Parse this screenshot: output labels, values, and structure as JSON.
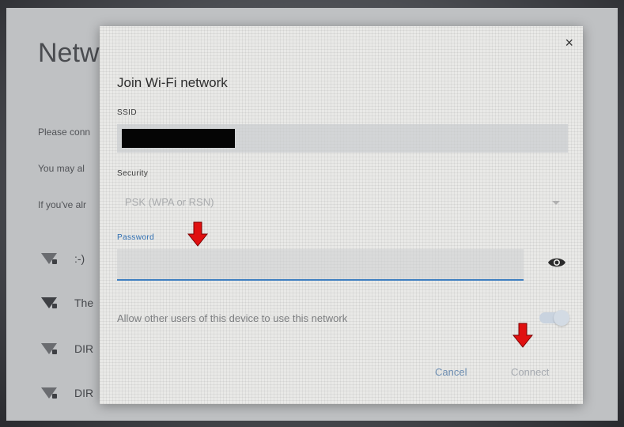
{
  "background_screen": {
    "title": "Netw",
    "lines": [
      "Please conn",
      "You may al",
      "If you've alr"
    ],
    "networks": [
      {
        "label": ":-)",
        "icon": "wifi-lock-icon"
      },
      {
        "label": "The",
        "icon": "wifi-lock-icon"
      },
      {
        "label": "DIR",
        "icon": "wifi-lock-icon"
      },
      {
        "label": "DIR",
        "icon": "wifi-lock-icon"
      }
    ]
  },
  "dialog": {
    "title": "Join Wi-Fi network",
    "close_label": "×",
    "ssid": {
      "label": "SSID",
      "value": "[redacted]"
    },
    "security": {
      "label": "Security",
      "value": "PSK (WPA or RSN)"
    },
    "password": {
      "label": "Password",
      "value": "",
      "show_icon": "eye-icon"
    },
    "share_option": {
      "label": "Allow other users of this device to use this network",
      "enabled": true
    },
    "buttons": {
      "cancel": "Cancel",
      "connect": "Connect"
    }
  },
  "annotations": [
    {
      "type": "red-down-arrow",
      "target": "password-label"
    },
    {
      "type": "red-down-arrow",
      "target": "connect-button"
    }
  ],
  "colors": {
    "accent": "#3f7fc0",
    "annotation": "#e01010",
    "dialog_bg": "#e9e9e7"
  }
}
